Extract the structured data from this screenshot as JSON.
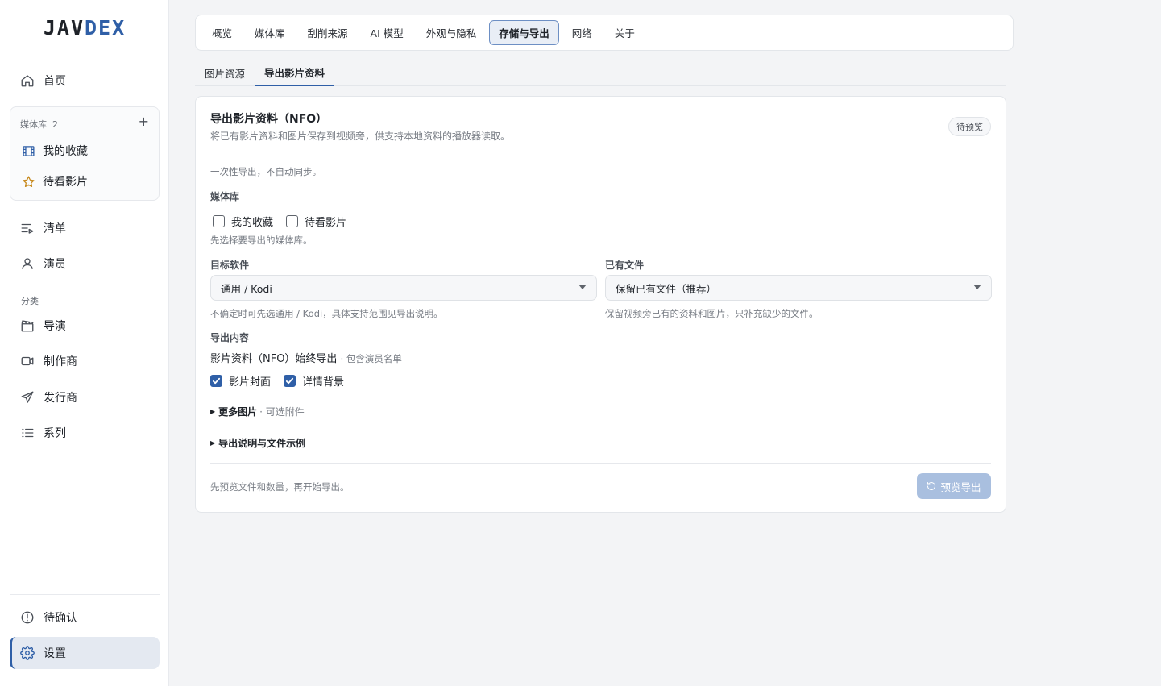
{
  "app": {
    "logo_a": "JAV",
    "logo_b": "DEX"
  },
  "sidebar": {
    "home": "首页",
    "library": {
      "header": "媒体库",
      "count": "2",
      "add": "+",
      "items": [
        "我的收藏",
        "待看影片"
      ]
    },
    "lists": "清单",
    "actors": "演员",
    "category_label": "分类",
    "categories": [
      "导演",
      "制作商",
      "发行商",
      "系列"
    ],
    "pending": "待确认",
    "settings": "设置"
  },
  "top_tabs": [
    "概览",
    "媒体库",
    "刮削来源",
    "AI 模型",
    "外观与隐私",
    "存储与导出",
    "网络",
    "关于"
  ],
  "active_top_tab": "存储与导出",
  "sub_tabs": [
    "图片资源",
    "导出影片资料"
  ],
  "active_sub_tab": "导出影片资料",
  "card": {
    "title": "导出影片资料（NFO）",
    "description": "将已有影片资料和图片保存到视频旁，供支持本地资料的播放器读取。",
    "badge": "待预览",
    "note": "一次性导出，不自动同步。",
    "library_label": "媒体库",
    "library_options": [
      {
        "label": "我的收藏",
        "checked": false
      },
      {
        "label": "待看影片",
        "checked": false
      }
    ],
    "library_hint": "先选择要导出的媒体库。",
    "target_label": "目标软件",
    "target_value": "通用 / Kodi",
    "target_hint": "不确定时可先选通用 / Kodi，具体支持范围见导出说明。",
    "existing_label": "已有文件",
    "existing_value": "保留已有文件（推荐）",
    "existing_hint": "保留视频旁已有的资料和图片，只补充缺少的文件。",
    "content_label": "导出内容",
    "nfo_line": "影片资料（NFO）始终导出",
    "nfo_sub": "· 包含演员名单",
    "content_options": [
      {
        "label": "影片封面",
        "checked": true
      },
      {
        "label": "详情背景",
        "checked": true
      }
    ],
    "more_images": "更多图片",
    "more_images_sub": "· 可选附件",
    "export_notes": "导出说明与文件示例",
    "footer_hint": "先预览文件和数量，再开始导出。",
    "preview_button": "预览导出"
  }
}
